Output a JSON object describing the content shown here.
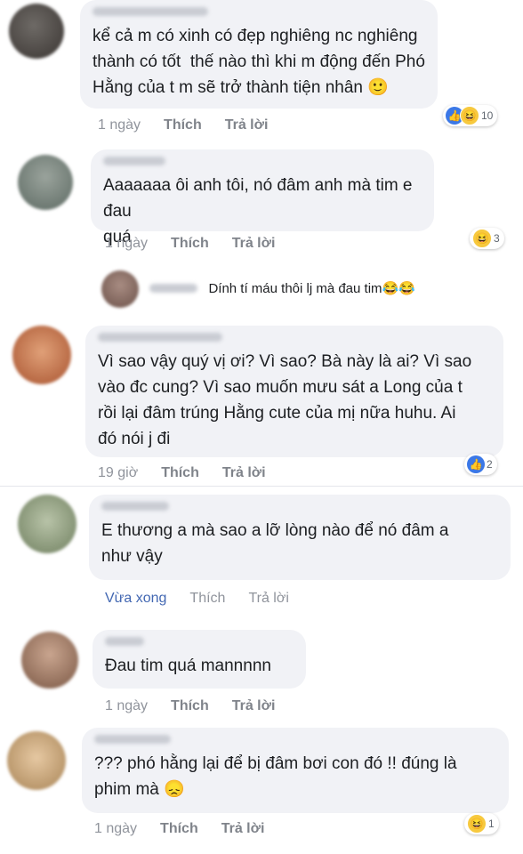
{
  "comments": [
    {
      "text": "kể cả m có xinh có đẹp nghiêng nc nghiêng\nthành có tốt  thế nào thì khi m động đến Phó\nHằng của t m sẽ trở thành tiện nhân 🙂",
      "time": "1 ngày",
      "like": "Thích",
      "reply": "Trả lời",
      "reactions": {
        "icons": [
          "like-icon",
          "haha-icon"
        ],
        "count": "10"
      }
    },
    {
      "text": "Aaaaaaa ôi anh tôi, nó đâm anh mà tim e đau\nquá",
      "time": "1 ngày",
      "like": "Thích",
      "reply": "Trả lời",
      "reactions": {
        "icons": [
          "haha-icon"
        ],
        "count": "3"
      }
    },
    {
      "text": "Vì sao vậy quý vị ơi? Vì sao? Bà này là ai? Vì sao\nvào đc cung? Vì sao muốn mưu sát a Long của t\nrồi lại đâm trúng Hằng cute của mị nữa huhu. Ai\nđó nói j đi",
      "time": "19 giờ",
      "like": "Thích",
      "reply": "Trả lời",
      "reactions": {
        "icons": [
          "like-icon"
        ],
        "count": "2"
      }
    },
    {
      "text": "E thương a mà sao a lỡ lòng nào để nó đâm a\nnhư vậy",
      "time": "Vừa xong",
      "like": "Thích",
      "reply": "Trả lời"
    },
    {
      "text": "Đau tim quá mannnnn",
      "time": "1 ngày",
      "like": "Thích",
      "reply": "Trả lời"
    },
    {
      "text": "??? phó hằng lại để bị đâm bơi con đó !! đúng là\nphim mà 😞",
      "time": "1 ngày",
      "like": "Thích",
      "reply": "Trả lời",
      "reactions": {
        "icons": [
          "haha-icon"
        ],
        "count": "1"
      }
    }
  ],
  "reply_preview": {
    "text": "Dính tí máu thôi lj mà đau tim😂😂"
  },
  "colors": {
    "bubble": "#f1f2f6",
    "meta": "#90949c",
    "link_blue": "#4267b2",
    "like_blue": "#3b78e7",
    "haha_yellow": "#f7c93e"
  }
}
